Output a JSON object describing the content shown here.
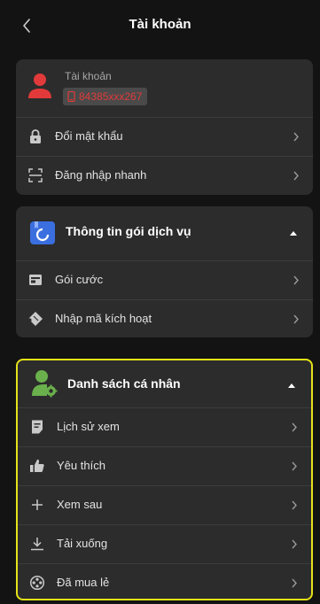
{
  "header": {
    "title": "Tài khoản"
  },
  "account": {
    "label": "Tài khoản",
    "id": "84385xxx267",
    "rows": [
      {
        "icon": "lock-icon",
        "label": "Đổi mật khẩu"
      },
      {
        "icon": "scan-icon",
        "label": "Đăng nhập nhanh"
      }
    ]
  },
  "service": {
    "title": "Thông tin gói dịch vụ",
    "rows": [
      {
        "icon": "wallet-icon",
        "label": "Gói cước"
      },
      {
        "icon": "ticket-icon",
        "label": "Nhập mã kích hoạt"
      }
    ]
  },
  "personal": {
    "title": "Danh sách cá nhân",
    "rows": [
      {
        "icon": "history-icon",
        "label": "Lịch sử xem"
      },
      {
        "icon": "thumbs-up-icon",
        "label": "Yêu thích"
      },
      {
        "icon": "plus-icon",
        "label": "Xem sau"
      },
      {
        "icon": "download-icon",
        "label": "Tải xuống"
      },
      {
        "icon": "film-reel-icon",
        "label": "Đã mua lẻ"
      }
    ]
  },
  "colors": {
    "background": "#131313",
    "card": "#2c2c2c",
    "highlight_border": "#e4e219",
    "accent_red": "#e23a3a",
    "service_icon_blue": "#3b6fe0",
    "personal_icon_green": "#6ab04c"
  }
}
